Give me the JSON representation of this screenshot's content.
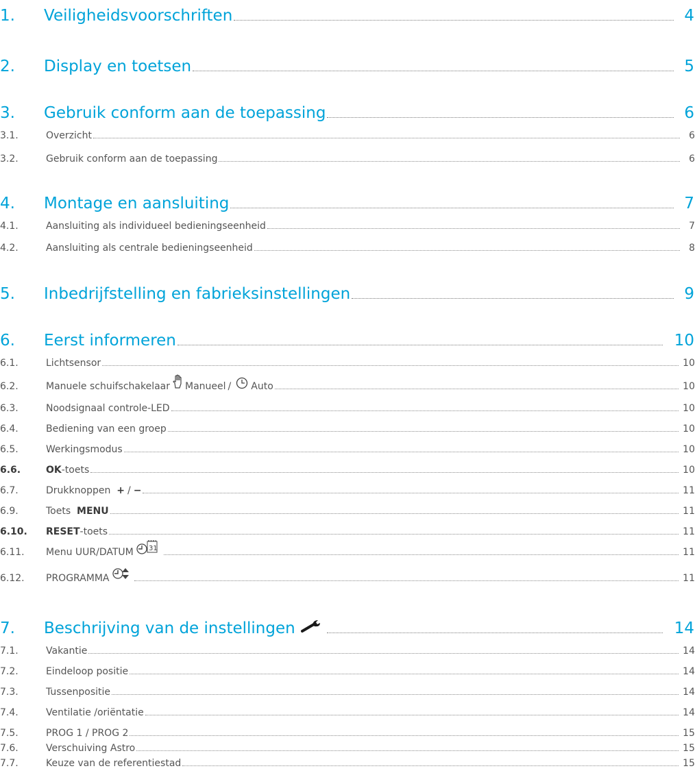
{
  "toc": {
    "ch1": {
      "num": "1.",
      "title": "Veiligheidsvoorschriften",
      "page": "4"
    },
    "ch2": {
      "num": "2.",
      "title": "Display en toetsen",
      "page": "5"
    },
    "ch3": {
      "num": "3.",
      "title": "Gebruik conform aan de toepassing",
      "page": "6"
    },
    "s3_1": {
      "num": "3.1.",
      "title": "Overzicht",
      "page": "6"
    },
    "s3_2": {
      "num": "3.2.",
      "title": "Gebruik conform aan de toepassing",
      "page": "6"
    },
    "ch4": {
      "num": "4.",
      "title": "Montage en aansluiting",
      "page": "7"
    },
    "s4_1": {
      "num": "4.1.",
      "title": "Aansluiting als individueel bedieningseenheid",
      "page": "7"
    },
    "s4_2": {
      "num": "4.2.",
      "title": "Aansluiting als centrale bedieningseenheid",
      "page": "8"
    },
    "ch5": {
      "num": "5.",
      "title": "Inbedrijfstelling en fabrieksinstellingen",
      "page": "9"
    },
    "ch6": {
      "num": "6.",
      "title": "Eerst informeren",
      "page": "10"
    },
    "s6_1": {
      "num": "6.1.",
      "title": "Lichtsensor",
      "page": "10"
    },
    "s6_2": {
      "num": "6.2.",
      "title_a": "Manuele schuifschakelaar",
      "title_b": "Manueel",
      "slash": "/",
      "title_c": "Auto",
      "page": "10",
      "icon1": "hand-icon",
      "icon2": "clock-icon"
    },
    "s6_3": {
      "num": "6.3.",
      "title": "Noodsignaal controle-LED",
      "page": "10"
    },
    "s6_4": {
      "num": "6.4.",
      "title": "Bediening van een groep",
      "page": "10"
    },
    "s6_5": {
      "num": "6.5.",
      "title": "Werkingsmodus",
      "page": "10"
    },
    "s6_6": {
      "num": "6.6.",
      "bold": "OK",
      "title": "-toets",
      "page": "10"
    },
    "s6_7": {
      "num": "6.7.",
      "title": "Drukknoppen",
      "plus": "+",
      "slash": "/",
      "minus": "−",
      "page": "11"
    },
    "s6_9": {
      "num": "6.9.",
      "title": "Toets",
      "bold": "MENU",
      "page": "11"
    },
    "s6_10": {
      "num": "6.10.",
      "bold": "RESET",
      "title": "-toets",
      "page": "11"
    },
    "s6_11": {
      "num": "6.11.",
      "title": "Menu UUR/DATUM",
      "icon_text": "31",
      "page": "11",
      "icon": "clock-calendar-icon"
    },
    "s6_12": {
      "num": "6.12.",
      "title": "PROGRAMMA",
      "page": "11",
      "icon": "clock-arrows-icon"
    },
    "ch7": {
      "num": "7.",
      "title": "Beschrijving van de instellingen",
      "page": "14",
      "icon": "wrench-icon"
    },
    "s7_1": {
      "num": "7.1.",
      "title": "Vakantie",
      "page": "14"
    },
    "s7_2": {
      "num": "7.2.",
      "title": "Eindeloop positie",
      "page": "14"
    },
    "s7_3": {
      "num": "7.3.",
      "title": "Tussenpositie",
      "page": "14"
    },
    "s7_4": {
      "num": "7.4.",
      "title": "Ventilatie /oriëntatie",
      "page": "14"
    },
    "s7_5": {
      "num": "7.5.",
      "title": "PROG 1 / PROG 2",
      "page": "15"
    },
    "s7_6": {
      "num": "7.6.",
      "title": "Verschuiving Astro",
      "page": "15"
    },
    "s7_7": {
      "num": "7.7.",
      "title": "Keuze van de referentiestad",
      "page": "15"
    }
  },
  "colors": {
    "accent": "#00a3d9",
    "text": "#555555"
  }
}
